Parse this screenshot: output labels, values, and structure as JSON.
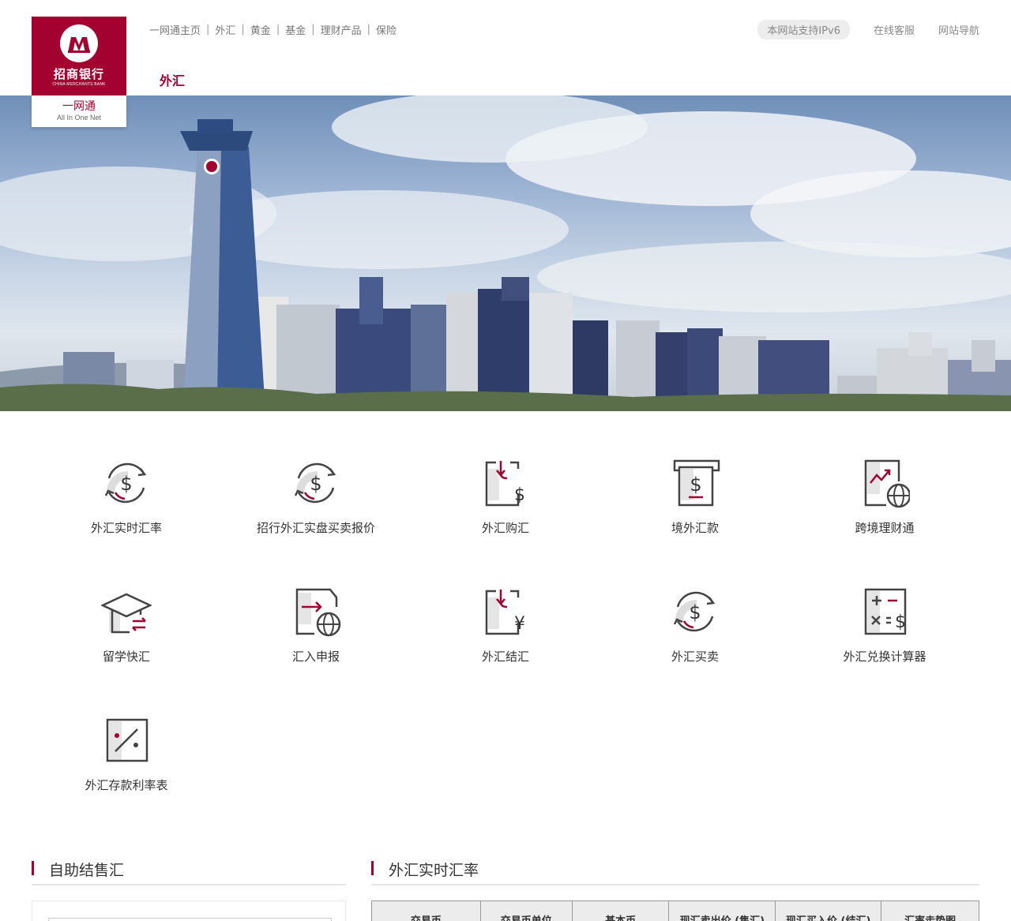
{
  "brand": {
    "name_cn": "招商银行",
    "name_en": "CHINA MERCHANTS BANK",
    "product_cn": "一网通",
    "product_en": "All In One Net",
    "color": "#a3012f"
  },
  "topnav": {
    "items": [
      "一网通主页",
      "外汇",
      "黄金",
      "基金",
      "理财产品",
      "保险"
    ],
    "separator": "|"
  },
  "header": {
    "section_title": "外汇",
    "ipv6_badge": "本网站支持IPv6",
    "online_service": "在线客服",
    "site_nav": "网站导航"
  },
  "tiles": [
    {
      "label": "外汇实时汇率",
      "icon": "exchange-dollar-icon"
    },
    {
      "label": "招行外汇实盘买卖报价",
      "icon": "exchange-dollar-icon"
    },
    {
      "label": "外汇购汇",
      "icon": "document-dollar-icon"
    },
    {
      "label": "境外汇款",
      "icon": "atm-dollar-icon"
    },
    {
      "label": "跨境理财通",
      "icon": "chart-globe-icon"
    },
    {
      "label": "留学快汇",
      "icon": "graduation-cap-icon"
    },
    {
      "label": "汇入申报",
      "icon": "document-globe-icon"
    },
    {
      "label": "外汇结汇",
      "icon": "document-yuan-icon"
    },
    {
      "label": "外汇买卖",
      "icon": "exchange-dollar-icon"
    },
    {
      "label": "外汇兑换计算器",
      "icon": "calculator-icon"
    },
    {
      "label": "外汇存款利率表",
      "icon": "percent-icon"
    }
  ],
  "sections": {
    "self_service": "自助结售汇",
    "realtime_rates": "外汇实时汇率"
  },
  "rate_table": {
    "headers": [
      "交易币",
      "交易币单位",
      "基本币",
      "现汇卖出价 (售汇)",
      "现汇买入价 (结汇)",
      "汇率走势图"
    ]
  }
}
